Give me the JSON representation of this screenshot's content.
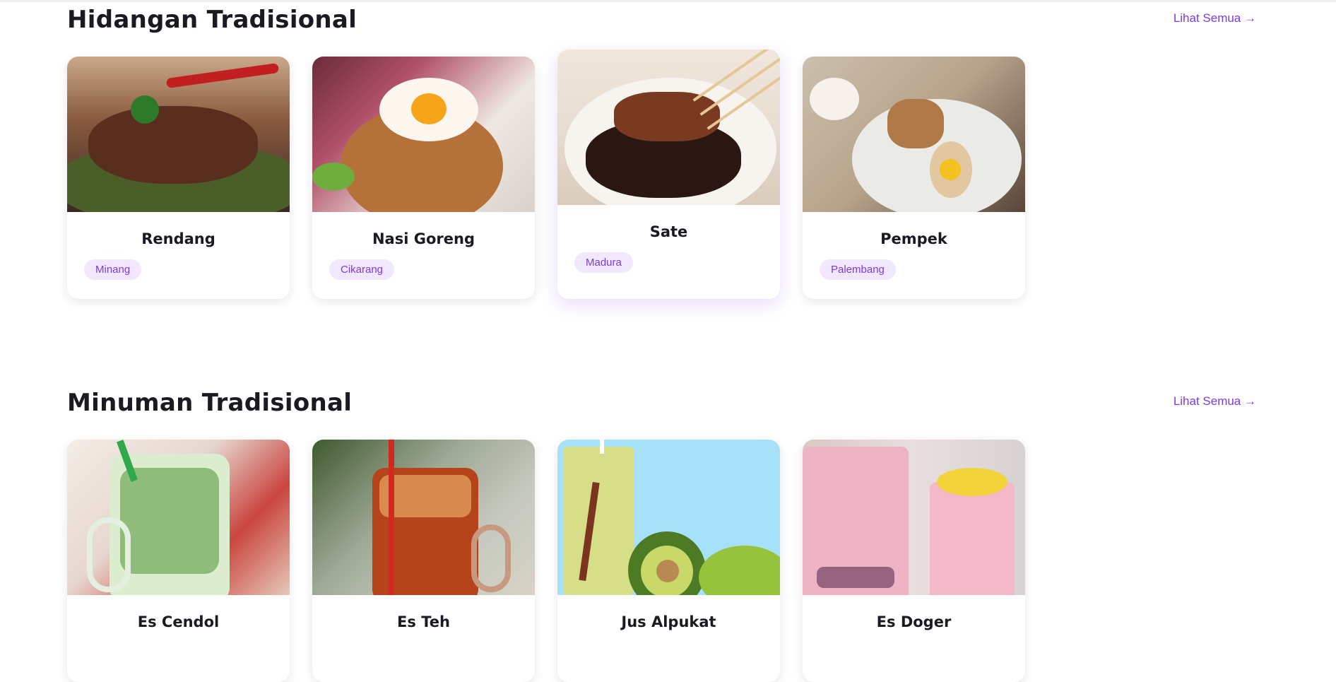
{
  "sections": [
    {
      "title": "Hidangan Tradisional",
      "see_all": "Lihat Semua →",
      "items": [
        {
          "name": "Rendang",
          "origin": "Minang"
        },
        {
          "name": "Nasi Goreng",
          "origin": "Cikarang"
        },
        {
          "name": "Sate",
          "origin": "Madura"
        },
        {
          "name": "Pempek",
          "origin": "Palembang"
        }
      ]
    },
    {
      "title": "Minuman Tradisional",
      "see_all": "Lihat Semua →",
      "items": [
        {
          "name": "Es Cendol",
          "origin": ""
        },
        {
          "name": "Es Teh",
          "origin": ""
        },
        {
          "name": "Jus Alpukat",
          "origin": ""
        },
        {
          "name": "Es Doger",
          "origin": ""
        }
      ]
    }
  ],
  "colors": {
    "accent": "#7b3ae0",
    "badge_bg": "#f1e8fd",
    "title_text": "#1a1a22"
  }
}
